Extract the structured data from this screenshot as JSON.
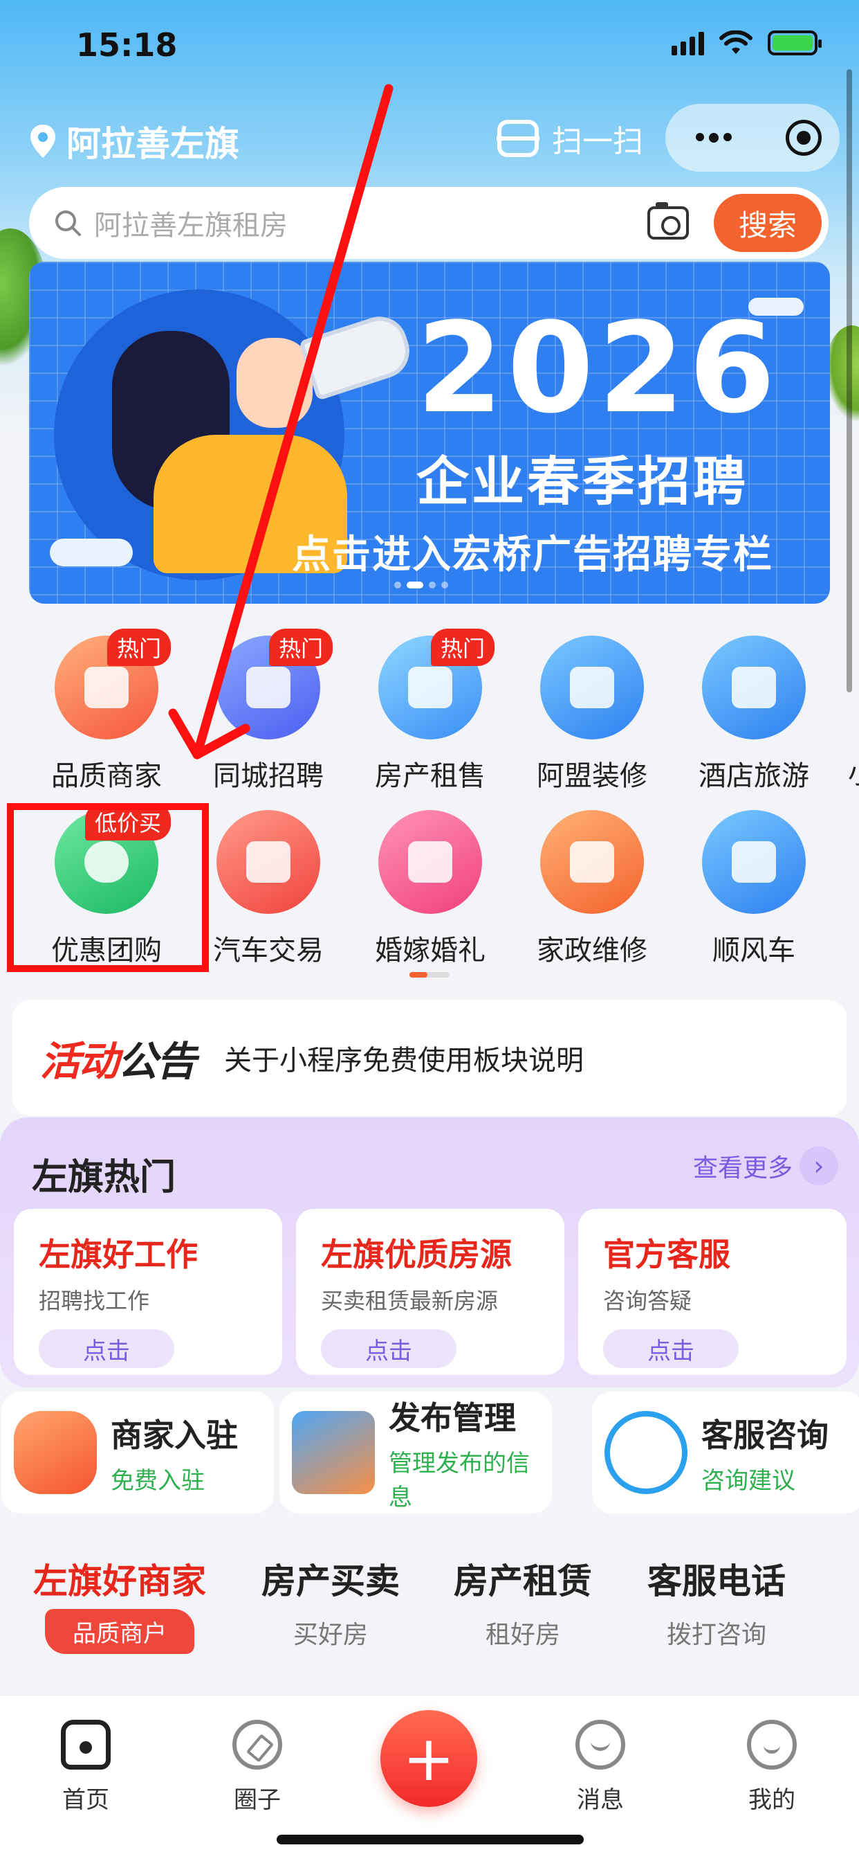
{
  "status_bar": {
    "time": "15:18"
  },
  "header": {
    "location": "阿拉善左旗",
    "scan_label": "扫一扫"
  },
  "search": {
    "placeholder": "阿拉善左旗租房",
    "button": "搜索"
  },
  "banner": {
    "year": "2026",
    "title": "企业春季招聘",
    "subtitle": "点击进入宏桥广告招聘专栏"
  },
  "grid": {
    "row1": [
      {
        "label": "品质商家",
        "badge": "热门",
        "icon": "store-icon"
      },
      {
        "label": "同城招聘",
        "badge": "热门",
        "icon": "recruit-icon"
      },
      {
        "label": "房产租售",
        "badge": "热门",
        "icon": "building-icon"
      },
      {
        "label": "阿盟装修",
        "badge": "",
        "icon": "paint-roller-icon"
      },
      {
        "label": "酒店旅游",
        "badge": "",
        "icon": "palm-tree-icon"
      }
    ],
    "row1_partial": "小",
    "row2": [
      {
        "label": "优惠团购",
        "badge": "低价买",
        "icon": "alarm-clock-icon"
      },
      {
        "label": "汽车交易",
        "badge": "",
        "icon": "car-icon"
      },
      {
        "label": "婚嫁婚礼",
        "badge": "",
        "icon": "wedding-building-icon"
      },
      {
        "label": "家政维修",
        "badge": "",
        "icon": "broom-icon"
      },
      {
        "label": "顺风车",
        "badge": "",
        "icon": "carpool-icon"
      }
    ]
  },
  "notice": {
    "logo_red": "活动",
    "logo_dark": "公告",
    "text": "关于小程序免费使用板块说明"
  },
  "hot": {
    "title": "左旗热门",
    "more": "查看更多",
    "cards": [
      {
        "title": "左旗好工作",
        "sub": "招聘找工作",
        "button": "点击"
      },
      {
        "title": "左旗优质房源",
        "sub": "买卖租赁最新房源",
        "button": "点击"
      },
      {
        "title": "官方客服",
        "sub": "咨询答疑",
        "button": "点击"
      }
    ]
  },
  "services": [
    {
      "title": "商家入驻",
      "sub": "免费入驻",
      "icon": "shop-icon"
    },
    {
      "title": "发布管理",
      "sub": "管理发布的信息",
      "icon": "edit-card-icon"
    },
    {
      "title": "客服咨询",
      "sub": "咨询建议",
      "icon": "phone-icon"
    }
  ],
  "links": [
    {
      "title": "左旗好商家",
      "sub": "品质商户"
    },
    {
      "title": "房产买卖",
      "sub": "买好房"
    },
    {
      "title": "房产租赁",
      "sub": "租好房"
    },
    {
      "title": "客服电话",
      "sub": "拨打咨询"
    }
  ],
  "tabbar": {
    "home": "首页",
    "circle": "圈子",
    "plus": "+",
    "messages": "消息",
    "me": "我的"
  },
  "colors": {
    "accent": "#f4622d",
    "highlight_red": "#ff1010",
    "hot_bg": "#e3d4fb"
  }
}
